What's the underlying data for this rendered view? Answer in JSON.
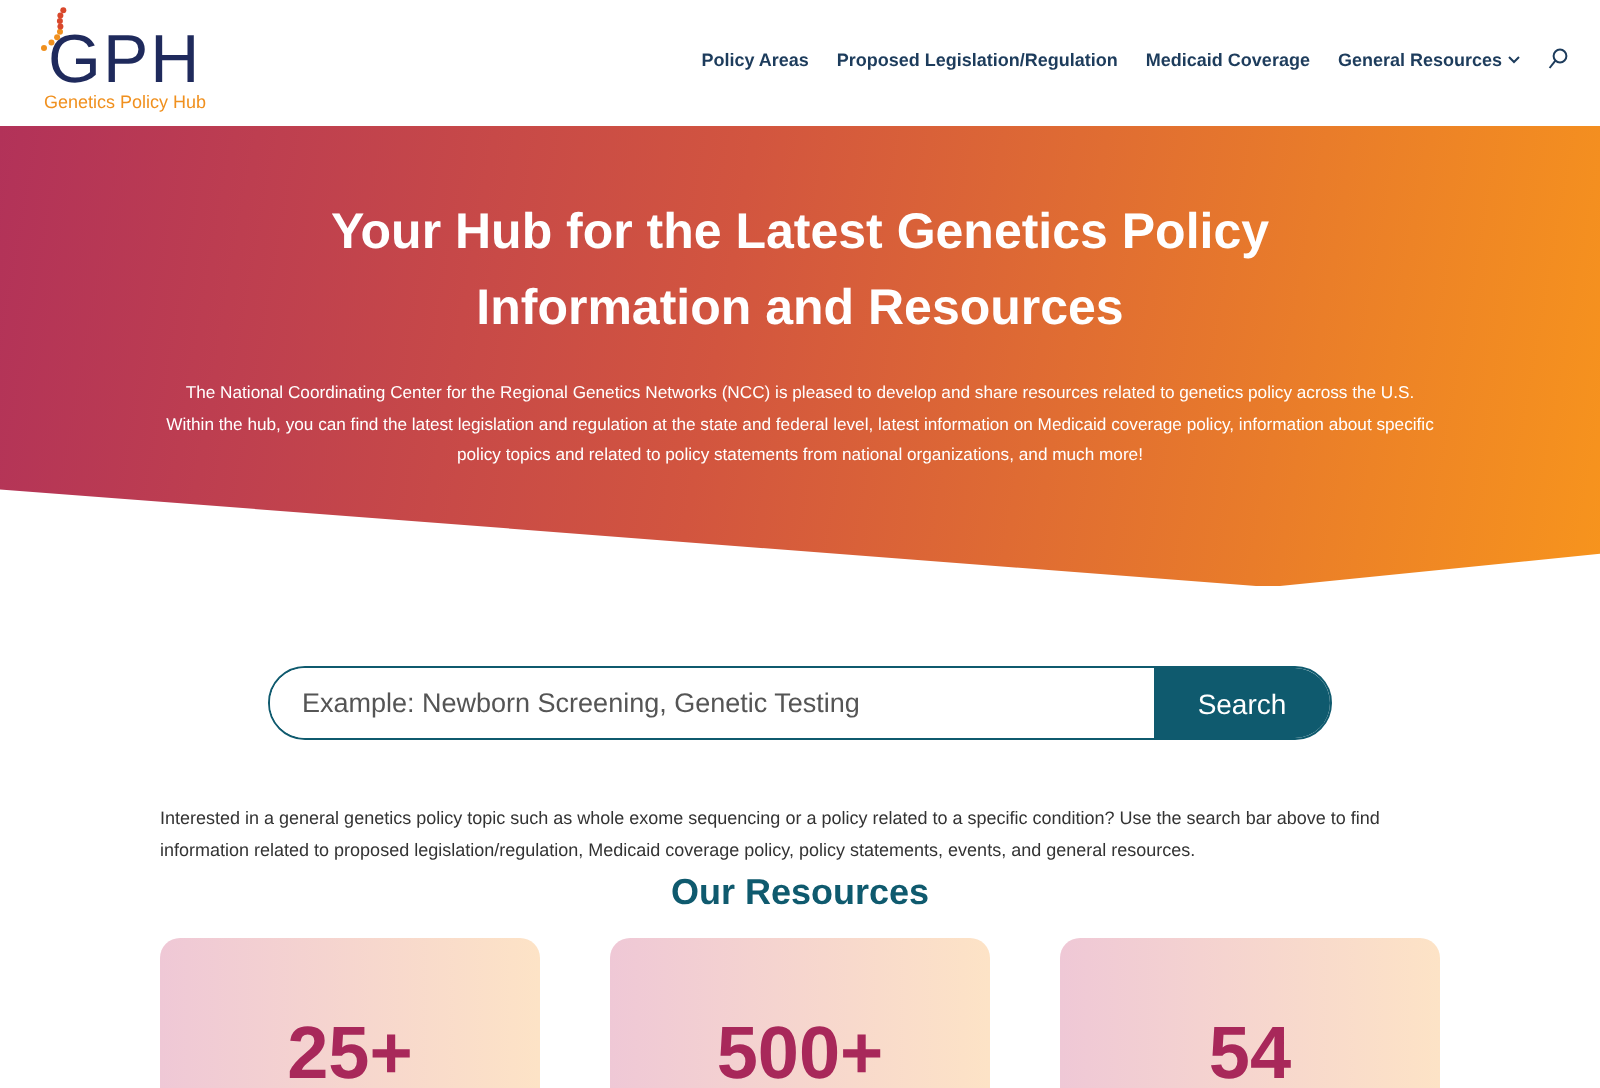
{
  "logo": {
    "letters": "GPH",
    "tagline": "Genetics Policy Hub"
  },
  "nav": {
    "items": [
      {
        "label": "Policy Areas",
        "has_menu": false
      },
      {
        "label": "Proposed Legislation/Regulation",
        "has_menu": false
      },
      {
        "label": "Medicaid Coverage",
        "has_menu": false
      },
      {
        "label": "General Resources",
        "has_menu": true
      }
    ]
  },
  "hero": {
    "title": "Your Hub for the Latest Genetics Policy Information and Resources",
    "text": "The National Coordinating Center for the Regional Genetics Networks (NCC) is pleased to develop and share resources related to genetics policy across the U.S. Within the hub, you can find the latest legislation and regulation at the state and federal level, latest information on Medicaid coverage policy, information about specific policy topics and related to policy statements from national organizations, and much more!"
  },
  "search": {
    "placeholder": "Example: Newborn Screening, Genetic Testing",
    "button": "Search"
  },
  "intro": "Interested in a general genetics policy topic such as whole exome sequencing or a policy related to a specific condition? Use the search bar above to find information related to proposed legislation/regulation, Medicaid coverage policy, policy statements, events, and general resources.",
  "resources": {
    "heading": "Our Resources",
    "cards": [
      {
        "value": "25+"
      },
      {
        "value": "500+"
      },
      {
        "value": "54"
      }
    ]
  }
}
